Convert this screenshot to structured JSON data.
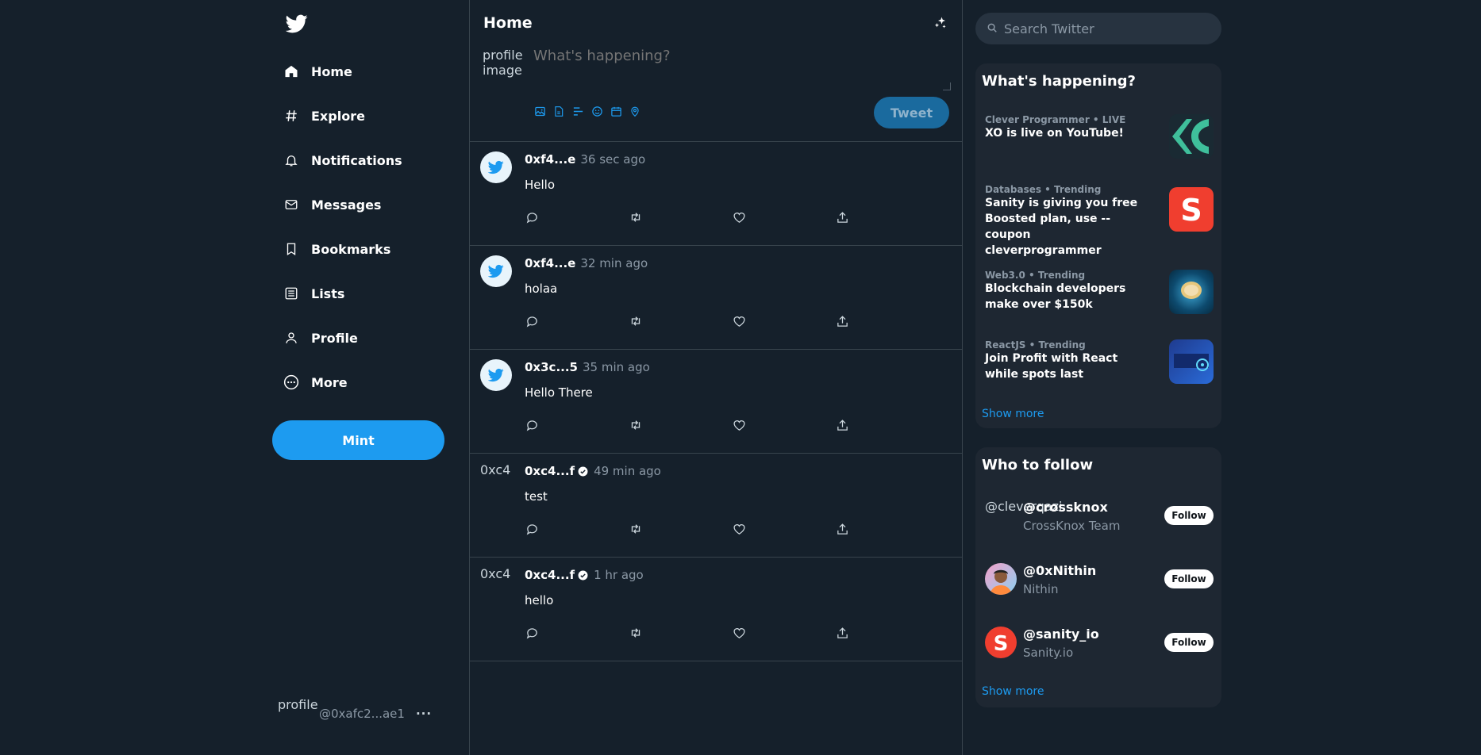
{
  "sidebar": {
    "logo_icon": "twitter-bird-icon",
    "items": [
      {
        "label": "Home",
        "icon": "home-icon"
      },
      {
        "label": "Explore",
        "icon": "hashtag-icon"
      },
      {
        "label": "Notifications",
        "icon": "bell-icon"
      },
      {
        "label": "Messages",
        "icon": "mail-icon"
      },
      {
        "label": "Bookmarks",
        "icon": "bookmark-icon"
      },
      {
        "label": "Lists",
        "icon": "list-icon"
      },
      {
        "label": "Profile",
        "icon": "user-icon"
      },
      {
        "label": "More",
        "icon": "more-circle-icon"
      }
    ],
    "mint_label": "Mint",
    "account": {
      "avatar_alt": "profile",
      "handle": "@0xafc2...ae1",
      "more": "···"
    }
  },
  "feed": {
    "title": "Home",
    "compose": {
      "avatar_alt": "profile image",
      "placeholder": "What's happening?",
      "tweet_label": "Tweet"
    },
    "tweets": [
      {
        "author": "0xf4...e",
        "time": "36 sec ago",
        "text": "Hello",
        "verified": false,
        "avatar": "twitter-bird"
      },
      {
        "author": "0xf4...e",
        "time": "32 min ago",
        "text": "holaa",
        "verified": false,
        "avatar": "twitter-bird"
      },
      {
        "author": "0x3c...5",
        "time": "35 min ago",
        "text": "Hello There",
        "verified": false,
        "avatar": "twitter-bird"
      },
      {
        "author": "0xc4...f",
        "time": "49 min ago",
        "text": "test",
        "verified": true,
        "avatar_alt": "0xc4"
      },
      {
        "author": "0xc4...f",
        "time": "1 hr ago",
        "text": "hello",
        "verified": true,
        "avatar_alt": "0xc4"
      }
    ]
  },
  "right": {
    "search_placeholder": "Search Twitter",
    "happening": {
      "title": "What's happening?",
      "trends": [
        {
          "category": "Clever Programmer • LIVE",
          "title": "XO is live on YouTube!"
        },
        {
          "category": "Databases • Trending",
          "title": "Sanity is giving you free Boosted plan, use --coupon cleverprogrammer"
        },
        {
          "category": "Web3.0 • Trending",
          "title": "Blockchain developers make over $150k"
        },
        {
          "category": "ReactJS • Trending",
          "title": "Join Profit with React while spots last"
        }
      ],
      "show_more": "Show more"
    },
    "who_to_follow": {
      "title": "Who to follow",
      "users": [
        {
          "handle": "@crossknox",
          "name": "CrossKnox Team",
          "avatar_alt": "@cleverqazi",
          "follow_label": "Follow"
        },
        {
          "handle": "@0xNithin",
          "name": "Nithin",
          "follow_label": "Follow"
        },
        {
          "handle": "@sanity_io",
          "name": "Sanity.io",
          "follow_label": "Follow"
        }
      ],
      "show_more": "Show more"
    }
  },
  "colors": {
    "background": "#15202b",
    "accent": "#1d9bf0",
    "panel": "#1e2732",
    "border": "#38444d",
    "muted_text": "#8b98a5"
  }
}
